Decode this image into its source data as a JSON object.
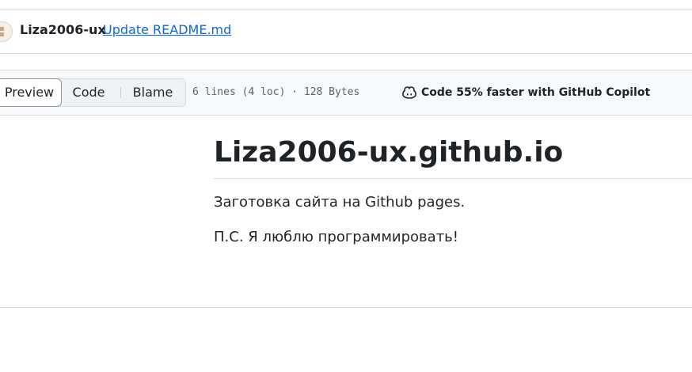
{
  "commit": {
    "author": "Liza2006-ux",
    "message": "Update README.md"
  },
  "toolbar": {
    "tabs": [
      {
        "label": "Preview",
        "selected": true
      },
      {
        "label": "Code",
        "selected": false
      },
      {
        "label": "Blame",
        "selected": false
      }
    ],
    "file_info": "6 lines (4 loc) · 128 Bytes",
    "copilot": {
      "icon": "copilot-icon",
      "label": "Code 55% faster with GitHub Copilot"
    }
  },
  "readme": {
    "title": "Liza2006-ux.github.io",
    "paragraphs": [
      "Заготовка сайта на Github pages.",
      "П.С. Я люблю программировать!"
    ]
  },
  "colors": {
    "link": "#0969da",
    "text": "#1f2328",
    "muted": "#59636e",
    "border": "#d0d7de",
    "toolbar_bg": "#f6f8fa"
  }
}
